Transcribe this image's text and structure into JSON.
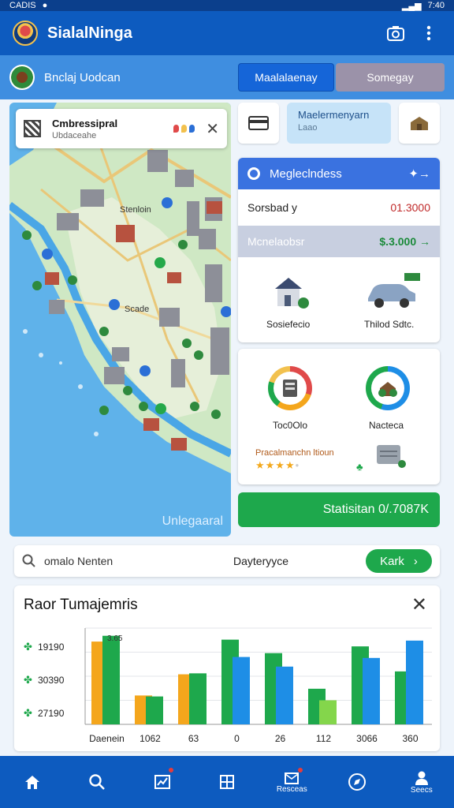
{
  "status": {
    "left": "CADIS",
    "time": "7:40"
  },
  "appbar": {
    "title": "SialalNinga",
    "icons": [
      "camera-icon",
      "more-vert-icon"
    ]
  },
  "subbar": {
    "label": "Bnclaj Uodcan",
    "tab_active": "Maalalaenay",
    "tab_inactive": "Somegay"
  },
  "map": {
    "card_title": "Cmbressipral",
    "card_subtitle": "Ubdaceahe",
    "labels": [
      "Stenloin",
      "Scade"
    ],
    "watermark": "Unlegaaral"
  },
  "tools": {
    "mid_title": "Maelermenyarn",
    "mid_sub": "Laao"
  },
  "panel": {
    "header": "Megleclndess",
    "row_label": "Sorsbad y",
    "row_value": "01.3000",
    "sub_label": "Mcnelaobsr",
    "sub_value": "$.3.000 →",
    "cells": [
      {
        "label": "Sosiefecio",
        "icon": "house-icon"
      },
      {
        "label": "Thilod Sdtc.",
        "icon": "car-icon"
      }
    ]
  },
  "panel2": {
    "ring1_label": "Toc0Olo",
    "ring2_label": "Nacteca",
    "rating_label": "Pracalmanchn ltioun",
    "rating": 4,
    "rating_max": 5
  },
  "cta": {
    "label": "Statisitan 0/.7087K"
  },
  "search": {
    "placeholder": "Search",
    "value": "omalo Nenten",
    "middle": "Dayteryyce",
    "button": "Kark"
  },
  "chart_card": {
    "title": "Raor Tumajemris"
  },
  "chart_data": {
    "type": "bar",
    "categories": [
      "Daenein",
      "1062",
      "63",
      "0",
      "26",
      "112",
      "3066",
      "360"
    ],
    "series": [
      {
        "color": "#f4a61c",
        "values": [
          86,
          30,
          52,
          0,
          0,
          0,
          0,
          0
        ]
      },
      {
        "color": "#1ea84c",
        "values": [
          92,
          29,
          53,
          88,
          74,
          37,
          81,
          55
        ]
      },
      {
        "color": "#1e8ee6",
        "values": [
          0,
          0,
          0,
          70,
          60,
          0,
          69,
          87
        ]
      },
      {
        "color": "#84d64b",
        "values": [
          0,
          0,
          0,
          0,
          0,
          25,
          0,
          0
        ]
      }
    ],
    "y_tick_labels": [
      "19190",
      "30390",
      "27190"
    ],
    "annotation": "3.65",
    "ylim": [
      0,
      100
    ]
  },
  "bottomnav": {
    "items": [
      {
        "icon": "home-icon",
        "label": ""
      },
      {
        "icon": "search-icon",
        "label": ""
      },
      {
        "icon": "chart-icon",
        "label": ""
      },
      {
        "icon": "grid-icon",
        "label": ""
      },
      {
        "icon": "mail-icon",
        "label": "Resceas"
      },
      {
        "icon": "compass-icon",
        "label": ""
      },
      {
        "icon": "profile-icon",
        "label": "Seecs"
      }
    ]
  }
}
